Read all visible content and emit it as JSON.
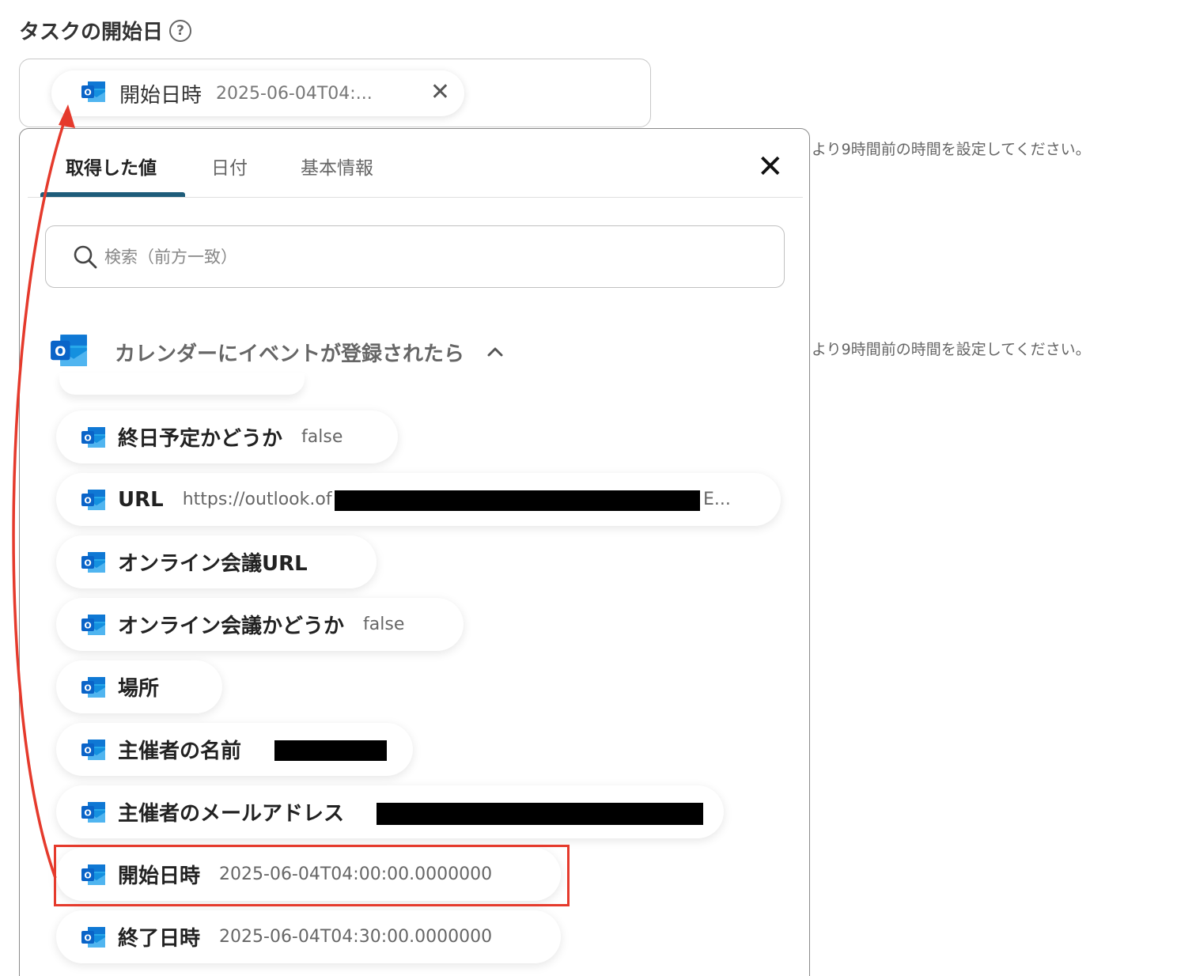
{
  "field": {
    "label": "タスクの開始日",
    "help": "?",
    "chip": {
      "label": "開始日時",
      "value": "2025-06-04T04:...",
      "close": "✕"
    }
  },
  "background_hints": [
    "より9時間前の時間を設定してください。",
    "より9時間前の時間を設定してください。"
  ],
  "panel": {
    "tabs": [
      "取得した値",
      "日付",
      "基本情報"
    ],
    "active_tab": 0,
    "close": "✕",
    "search_placeholder": "検索（前方一致）",
    "section_title": "カレンダーにイベントが登録されたら",
    "items": [
      {
        "label": "終日予定かどうか",
        "value": "false"
      },
      {
        "label": "URL",
        "value": "https://outlook.of",
        "value_tail": "E..."
      },
      {
        "label": "オンライン会議URL",
        "value": ""
      },
      {
        "label": "オンライン会議かどうか",
        "value": "false"
      },
      {
        "label": "場所",
        "value": ""
      },
      {
        "label": "主催者の名前",
        "value": ""
      },
      {
        "label": "主催者のメールアドレス",
        "value": ""
      },
      {
        "label": "開始日時",
        "value": "2025-06-04T04:00:00.0000000"
      },
      {
        "label": "終了日時",
        "value": "2025-06-04T04:30:00.0000000"
      }
    ]
  },
  "colors": {
    "tab_underline": "#1e5c7a",
    "highlight": "#e53a2c",
    "outlook_blue": "#0a64c8"
  },
  "icons": {
    "item_icon": "outlook-icon",
    "section_icon": "outlook-icon",
    "search_icon": "search-icon"
  }
}
